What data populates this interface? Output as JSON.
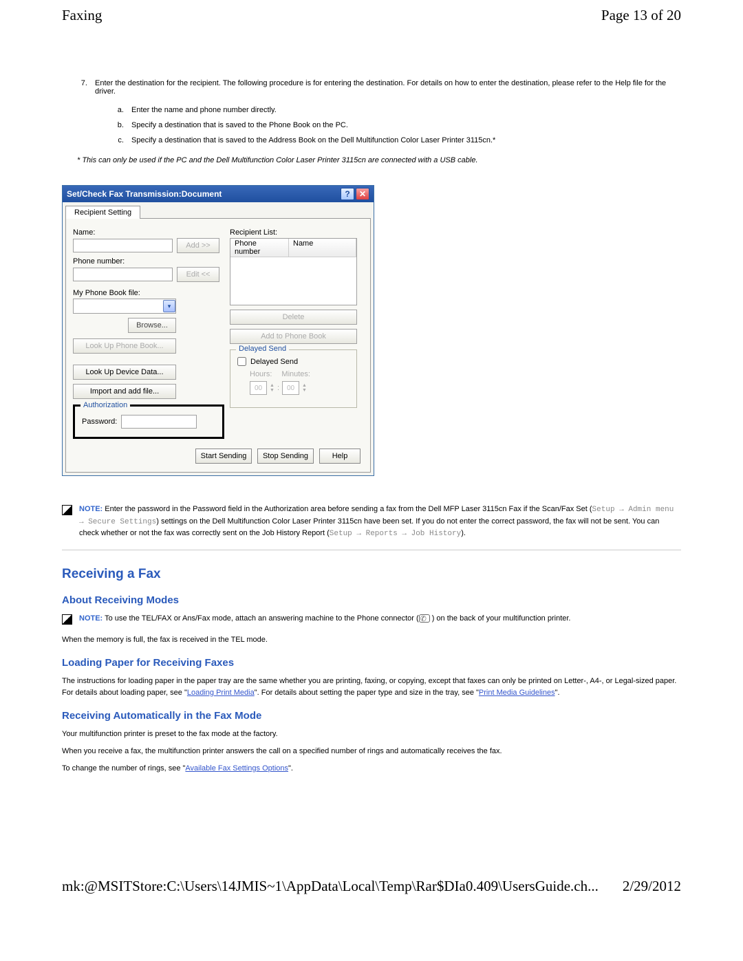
{
  "header": {
    "section": "Faxing",
    "page": "Page 13 of 20"
  },
  "step": {
    "num": "7.",
    "text": "Enter the destination for the recipient. The following procedure is for entering the destination. For details on how to enter the destination, please refer to the Help file for the driver.",
    "a": "Enter the name and phone number directly.",
    "b": "Specify a destination that is saved to the Phone Book on the PC.",
    "c": "Specify a destination that is saved to the Address Book on the Dell Multifunction Color Laser Printer 3115cn.*",
    "footnote": "* This can only be used if the PC and the Dell Multifunction Color Laser Printer 3115cn are connected with a USB cable."
  },
  "dialog": {
    "title": "Set/Check Fax Transmission:Document",
    "tab": "Recipient Setting",
    "name_label": "Name:",
    "phone_label": "Phone number:",
    "pb_label": "My Phone Book file:",
    "add": "Add >>",
    "edit": "Edit <<",
    "browse": "Browse...",
    "lookup_pb": "Look Up Phone Book...",
    "lookup_dev": "Look Up Device Data...",
    "import": "Import and add file...",
    "auth_legend": "Authorization",
    "password": "Password:",
    "rlist": "Recipient List:",
    "col_phone": "Phone number",
    "col_name": "Name",
    "delete": "Delete",
    "addpb": "Add to Phone Book",
    "delayed_legend": "Delayed Send",
    "delayed_chk": "Delayed Send",
    "hours": "Hours:",
    "minutes": "Minutes:",
    "spin": "00",
    "start": "Start Sending",
    "stop": "Stop Sending",
    "help": "Help"
  },
  "note1": {
    "label": "NOTE:",
    "t1": " Enter the password in the Password field in the Authorization area before sending a fax from the Dell MFP Laser 3115cn Fax if the Scan/Fax Set (",
    "p1": "Setup → Admin menu → Secure Settings",
    "t2": ") settings on the Dell Multifunction Color Laser Printer 3115cn have been set. If you do not enter the correct password, the fax will not be sent. You can check whether or not the fax was correctly sent on the Job History Report (",
    "p2": "Setup → Reports → Job History",
    "t3": ")."
  },
  "h2": "Receiving a Fax",
  "s1": {
    "h": "About Receiving Modes",
    "note_label": "NOTE:",
    "note_t1": " To use the TEL/FAX or Ans/Fax mode, attach an answering machine to the Phone connector (",
    "note_t2": " ) on the back of your multifunction printer.",
    "p": "When the memory is full, the fax is received in the TEL mode."
  },
  "s2": {
    "h": "Loading Paper for Receiving Faxes",
    "p1": "The instructions for loading paper in the paper tray are the same whether you are printing, faxing, or copying, except that faxes can only be printed on Letter-, A4-, or Legal-sized paper. For details about loading paper, see \"",
    "l1": "Loading Print Media",
    "p2": "\". For details about setting the paper type and size in the tray, see \"",
    "l2": "Print Media Guidelines",
    "p3": "\"."
  },
  "s3": {
    "h": "Receiving Automatically in the Fax Mode",
    "p1": "Your multifunction printer is preset to the fax mode at the factory.",
    "p2": "When you receive a fax, the multifunction printer answers the call on a specified number of rings and automatically receives the fax.",
    "p3a": "To change the number of rings, see \"",
    "l": "Available Fax Settings Options",
    "p3b": "\"."
  },
  "footer": {
    "path": "mk:@MSITStore:C:\\Users\\14JMIS~1\\AppData\\Local\\Temp\\Rar$DIa0.409\\UsersGuide.ch...",
    "date": "2/29/2012"
  }
}
